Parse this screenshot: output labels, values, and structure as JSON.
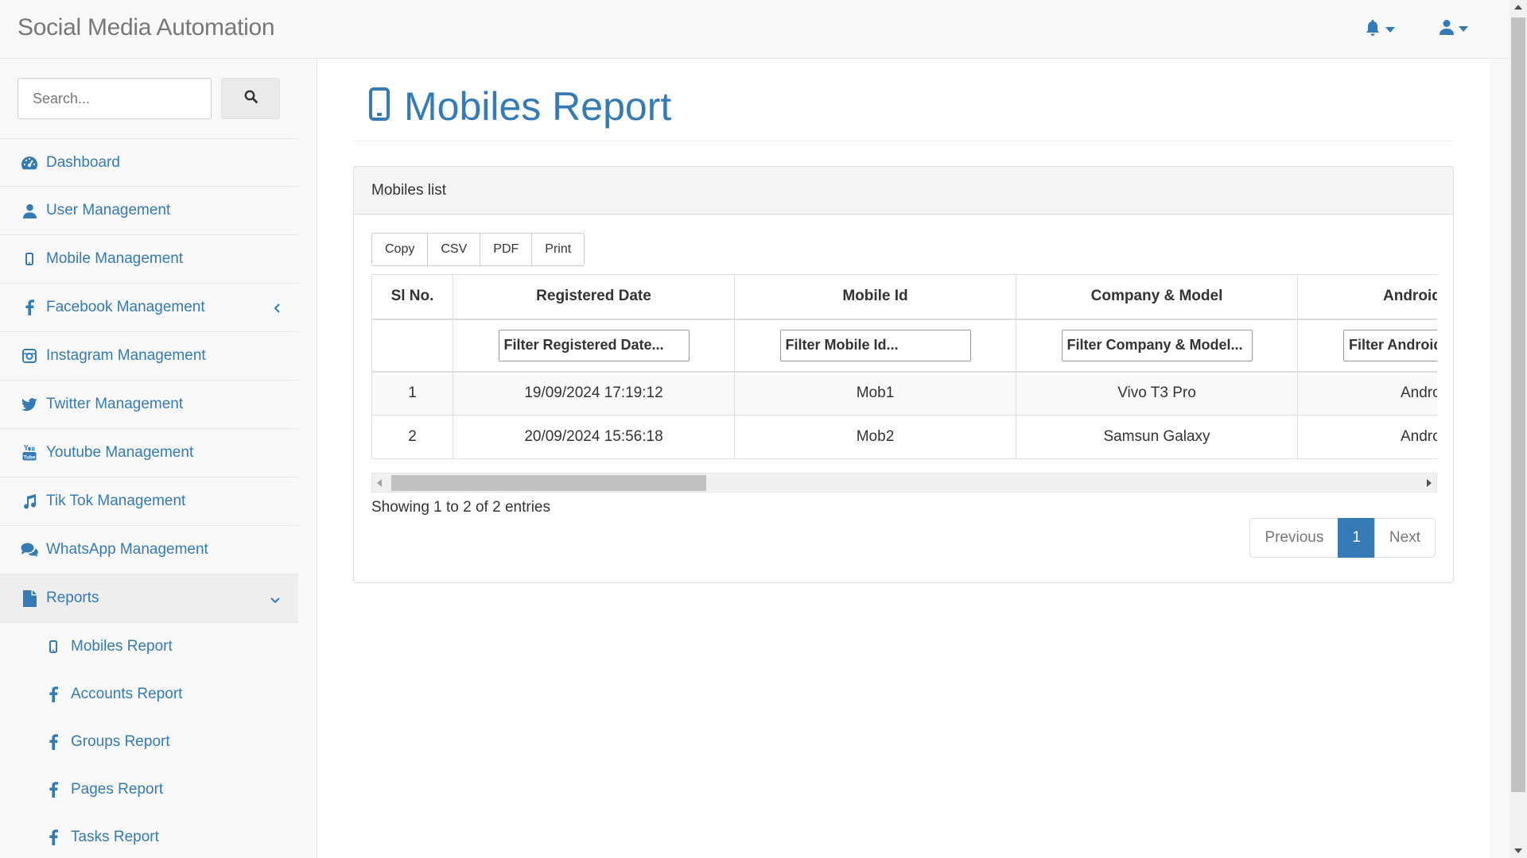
{
  "app": {
    "title": "Social Media Automation"
  },
  "navbar": {
    "bell_icon": "bell-icon",
    "user_icon": "user-icon"
  },
  "colors": {
    "accent": "#337ab7",
    "muted": "#777777",
    "sidebar_bg": "#f8f8f8"
  },
  "sidebar": {
    "search_placeholder": "Search...",
    "items": [
      {
        "label": "Dashboard",
        "icon": "dashboard-icon"
      },
      {
        "label": "User Management",
        "icon": "user-icon"
      },
      {
        "label": "Mobile Management",
        "icon": "mobile-icon"
      },
      {
        "label": "Facebook Management",
        "icon": "facebook-icon"
      },
      {
        "label": "Instagram Management",
        "icon": "instagram-icon"
      },
      {
        "label": "Twitter Management",
        "icon": "twitter-icon"
      },
      {
        "label": "Youtube Management",
        "icon": "youtube-icon"
      },
      {
        "label": "Tik Tok Management",
        "icon": "music-icon"
      },
      {
        "label": "WhatsApp Management",
        "icon": "comments-icon"
      },
      {
        "label": "Reports",
        "icon": "file-icon"
      }
    ],
    "reports_sub": [
      {
        "label": "Mobiles Report",
        "icon": "mobile-icon"
      },
      {
        "label": "Accounts Report",
        "icon": "facebook-icon"
      },
      {
        "label": "Groups Report",
        "icon": "facebook-icon"
      },
      {
        "label": "Pages Report",
        "icon": "facebook-icon"
      },
      {
        "label": "Tasks Report",
        "icon": "facebook-icon"
      }
    ]
  },
  "main": {
    "page_title": "Mobiles Report",
    "panel_title": "Mobiles list",
    "export_buttons": [
      "Copy",
      "CSV",
      "PDF",
      "Print"
    ],
    "table": {
      "columns": [
        "Sl No.",
        "Registered Date",
        "Mobile Id",
        "Company & Model",
        "Android"
      ],
      "filters": [
        "Filter Registered Date...",
        "Filter Mobile Id...",
        "Filter Company & Model...",
        "Filter Android..."
      ],
      "rows": [
        [
          "1",
          "19/09/2024 17:19:12",
          "Mob1",
          "Vivo T3 Pro",
          "Android"
        ],
        [
          "2",
          "20/09/2024 15:56:18",
          "Mob2",
          "Samsun Galaxy",
          "Android"
        ]
      ]
    },
    "info": "Showing 1 to 2 of 2 entries",
    "pagination": {
      "previous": "Previous",
      "current": "1",
      "next": "Next"
    }
  }
}
